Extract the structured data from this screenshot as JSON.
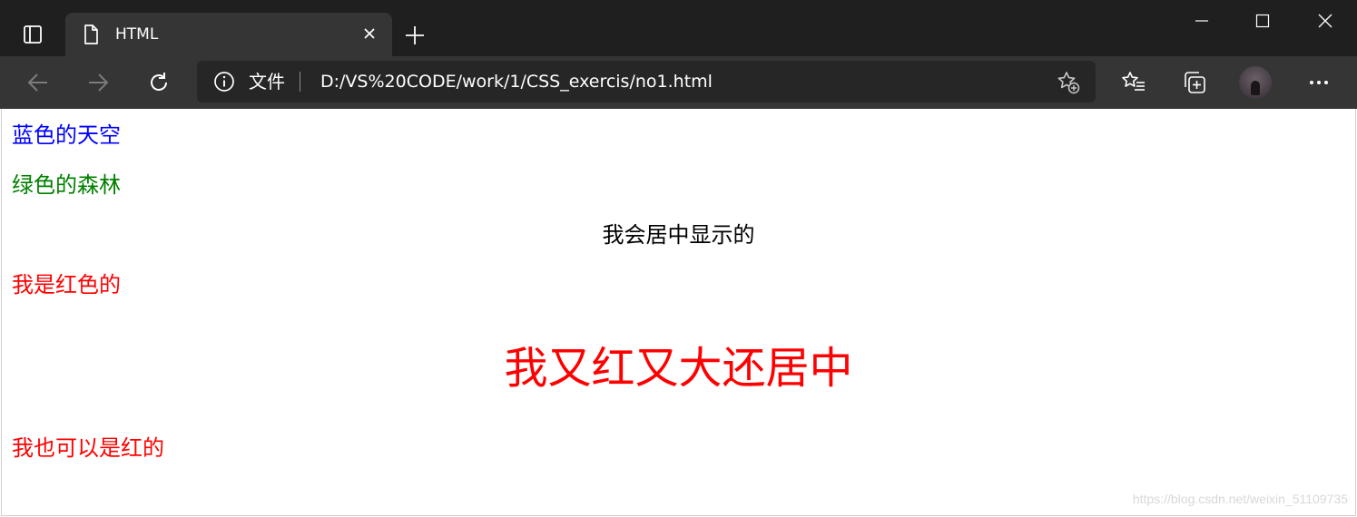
{
  "tab": {
    "title": "HTML"
  },
  "address_bar": {
    "site_label": "文件",
    "url": "D:/VS%20CODE/work/1/CSS_exercis/no1.html"
  },
  "content": {
    "line1": "蓝色的天空",
    "line2": "绿色的森林",
    "line3": "我会居中显示的",
    "line4": "我是红色的",
    "line5": "我又红又大还居中",
    "line6": "我也可以是红的"
  },
  "colors": {
    "blue": "#0000ff",
    "green": "#008000",
    "red": "#ff0000",
    "chrome_dark": "#1f1f1f",
    "chrome_tab": "#353535"
  },
  "watermark": "https://blog.csdn.net/weixin_51109735"
}
